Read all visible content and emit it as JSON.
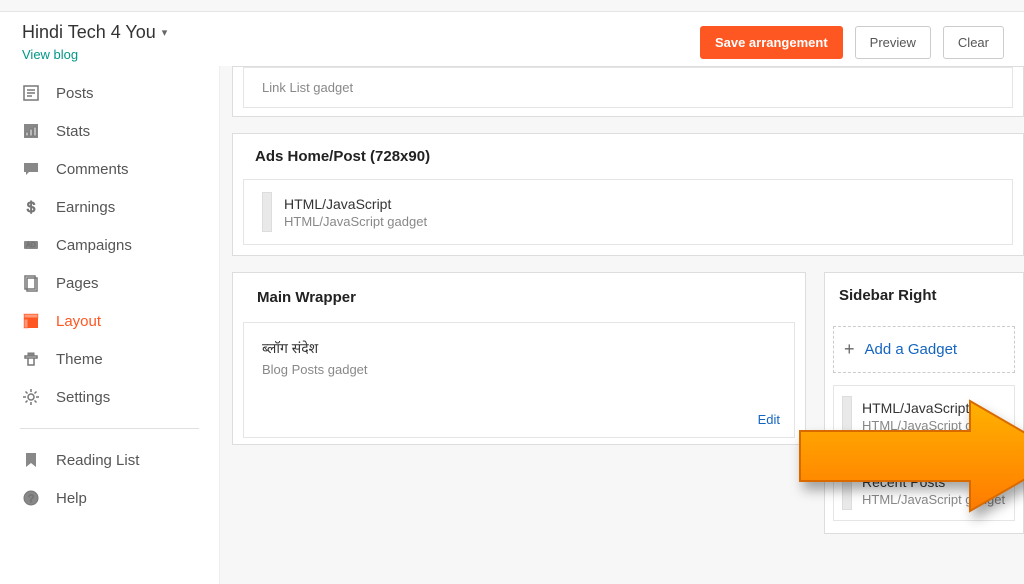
{
  "header": {
    "blog_title": "Hindi Tech 4 You",
    "view_blog": "View blog",
    "save": "Save arrangement",
    "preview": "Preview",
    "clear": "Clear"
  },
  "nav": {
    "posts": "Posts",
    "stats": "Stats",
    "comments": "Comments",
    "earnings": "Earnings",
    "campaigns": "Campaigns",
    "pages": "Pages",
    "layout": "Layout",
    "theme": "Theme",
    "settings": "Settings",
    "reading_list": "Reading List",
    "help": "Help"
  },
  "sections": {
    "linklist_sub": "Link List gadget",
    "ads_header": "Ads Home/Post (728x90)",
    "ads_gadget_title": "HTML/JavaScript",
    "ads_gadget_sub": "HTML/JavaScript gadget",
    "main_header": "Main Wrapper",
    "main_gadget_title": "ब्लॉग संदेश",
    "main_gadget_sub": "Blog Posts gadget",
    "edit": "Edit",
    "sidebar_header": "Sidebar Right",
    "add_gadget": "Add a Gadget",
    "side_g1_title": "HTML/JavaScript",
    "side_g1_sub": "HTML/JavaScript gadget",
    "side_g2_title": "Recent Posts",
    "side_g2_sub": "HTML/JavaScript gadget"
  }
}
